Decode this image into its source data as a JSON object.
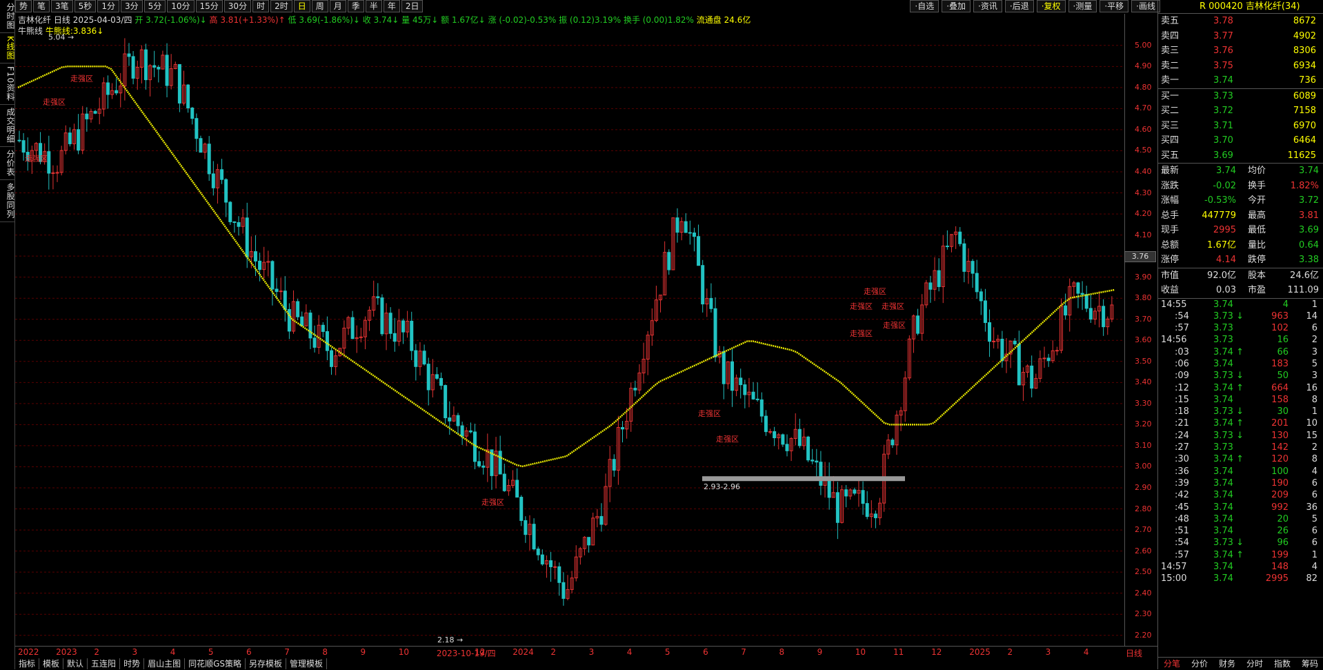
{
  "left_sidebar": [
    {
      "label": "分时图",
      "active": false
    },
    {
      "label": "K线图",
      "active": true
    },
    {
      "label": "F10资料",
      "active": false
    },
    {
      "label": "成交明细",
      "active": false
    },
    {
      "label": "分价表",
      "active": false
    },
    {
      "label": "多股同列",
      "active": false
    }
  ],
  "toolbar": [
    "势",
    "笔",
    "3笔",
    "5秒",
    "1分",
    "3分",
    "5分",
    "10分",
    "15分",
    "30分",
    "时",
    "2时",
    "日",
    "周",
    "月",
    "季",
    "半",
    "年",
    "2日"
  ],
  "toolbar_active": "日",
  "right_toolbar": [
    "自选",
    "叠加",
    "资讯",
    "后退",
    "复权",
    "测量",
    "平移",
    "画线"
  ],
  "right_toolbar_active": "复权",
  "info": {
    "stock": "吉林化纤",
    "period": "日线",
    "date": "2025-04-03/四",
    "open": "开 3.72(-1.06%)↓",
    "high": "高 3.81(+1.33%)↑",
    "low": "低 3.69(-1.86%)↓",
    "close": "收 3.74↓",
    "vol": "量 45万↓",
    "amount": "额 1.67亿↓",
    "change": "涨 (-0.02)-0.53%",
    "amp": "振 (0.12)3.19%",
    "turnover": "换手 (0.00)1.82%",
    "float": "流通盘 24.6亿",
    "indicator": "牛熊线",
    "indicator_val": "牛熊线:3.836↓"
  },
  "annotations": {
    "max": "5.04",
    "min": "2.18",
    "gap": "2.93-2.96",
    "zone_label": "走强区"
  },
  "price_badge": "3.76",
  "y_ticks": [
    "5.00",
    "4.90",
    "4.80",
    "4.70",
    "4.60",
    "4.50",
    "4.40",
    "4.30",
    "4.20",
    "4.10",
    "4.00",
    "3.90",
    "3.80",
    "3.70",
    "3.60",
    "3.50",
    "3.40",
    "3.30",
    "3.20",
    "3.10",
    "3.00",
    "2.90",
    "2.80",
    "2.70",
    "2.60",
    "2.50",
    "2.40",
    "2.30",
    "2.20"
  ],
  "x_ticks": [
    "2022",
    "2023",
    "2",
    "3",
    "4",
    "5",
    "6",
    "7",
    "8",
    "9",
    "10",
    "2023-10-19/四",
    "12",
    "2024",
    "2",
    "3",
    "4",
    "5",
    "6",
    "7",
    "8",
    "9",
    "10",
    "11",
    "12",
    "2025",
    "2",
    "3",
    "4"
  ],
  "x_axis_label": "日线",
  "bottom_toolbar": [
    "指标",
    "模板",
    "默认",
    "五连阳",
    "时势",
    "眉山主图",
    "同花顺GS策略",
    "另存模板",
    "管理模板"
  ],
  "panel": {
    "title": "R 000420 吉林化纤(34)",
    "asks": [
      [
        "卖五",
        "3.78",
        "8672"
      ],
      [
        "卖四",
        "3.77",
        "4902"
      ],
      [
        "卖三",
        "3.76",
        "8306"
      ],
      [
        "卖二",
        "3.75",
        "6934"
      ],
      [
        "卖一",
        "3.74",
        "736"
      ]
    ],
    "bids": [
      [
        "买一",
        "3.73",
        "6089"
      ],
      [
        "买二",
        "3.72",
        "7158"
      ],
      [
        "买三",
        "3.71",
        "6970"
      ],
      [
        "买四",
        "3.70",
        "6464"
      ],
      [
        "买五",
        "3.69",
        "11625"
      ]
    ],
    "stats": [
      [
        "最新",
        "3.74",
        "均价",
        "3.74"
      ],
      [
        "涨跌",
        "-0.02",
        "换手",
        "1.82%"
      ],
      [
        "涨幅",
        "-0.53%",
        "今开",
        "3.72"
      ],
      [
        "总手",
        "447779",
        "最高",
        "3.81"
      ],
      [
        "现手",
        "2995",
        "最低",
        "3.69"
      ],
      [
        "总额",
        "1.67亿",
        "量比",
        "0.64"
      ],
      [
        "涨停",
        "4.14",
        "跌停",
        "3.38"
      ]
    ],
    "cap": [
      [
        "市值",
        "92.0亿",
        "股本",
        "24.6亿"
      ],
      [
        "收益",
        "0.03",
        "市盈",
        "111.09"
      ]
    ],
    "ticks": [
      [
        "14:55",
        "3.74",
        "",
        "4",
        "1"
      ],
      [
        ":54",
        "3.73",
        "↓",
        "963",
        "14"
      ],
      [
        ":57",
        "3.73",
        "",
        "102",
        "6"
      ],
      [
        "14:56",
        "3.73",
        "",
        "16",
        "2"
      ],
      [
        ":03",
        "3.74",
        "↑",
        "66",
        "3"
      ],
      [
        ":06",
        "3.74",
        "",
        "183",
        "5"
      ],
      [
        ":09",
        "3.73",
        "↓",
        "50",
        "3"
      ],
      [
        ":12",
        "3.74",
        "↑",
        "664",
        "16"
      ],
      [
        ":15",
        "3.74",
        "",
        "158",
        "8"
      ],
      [
        ":18",
        "3.73",
        "↓",
        "30",
        "1"
      ],
      [
        ":21",
        "3.74",
        "↑",
        "201",
        "10"
      ],
      [
        ":24",
        "3.73",
        "↓",
        "130",
        "15"
      ],
      [
        ":27",
        "3.73",
        "",
        "142",
        "2"
      ],
      [
        ":30",
        "3.74",
        "↑",
        "120",
        "8"
      ],
      [
        ":36",
        "3.74",
        "",
        "100",
        "4"
      ],
      [
        ":39",
        "3.74",
        "",
        "190",
        "6"
      ],
      [
        ":42",
        "3.74",
        "",
        "209",
        "6"
      ],
      [
        ":45",
        "3.74",
        "",
        "992",
        "36"
      ],
      [
        ":48",
        "3.74",
        "",
        "20",
        "5"
      ],
      [
        ":51",
        "3.74",
        "",
        "26",
        "6"
      ],
      [
        ":54",
        "3.73",
        "↓",
        "96",
        "6"
      ],
      [
        ":57",
        "3.74",
        "↑",
        "199",
        "1"
      ],
      [
        "14:57",
        "3.74",
        "",
        "148",
        "4"
      ],
      [
        "15:00",
        "3.74",
        "",
        "2995",
        "82"
      ]
    ],
    "tabs": [
      "分笔",
      "分价",
      "财务",
      "分时",
      "指数",
      "筹码"
    ],
    "tab_active": "分笔"
  },
  "colors": {
    "up": "#e33333",
    "down": "#22c3c3",
    "ma": "#e8e800"
  },
  "chart_data": {
    "type": "candlestick",
    "ylim": [
      2.15,
      5.15
    ],
    "x": [
      "2022",
      "2023",
      "2",
      "3",
      "4",
      "5",
      "6",
      "7",
      "8",
      "9",
      "10",
      "2023-10-19/四",
      "12",
      "2024",
      "2",
      "3",
      "4",
      "5",
      "6",
      "7",
      "8",
      "9",
      "10",
      "11",
      "12",
      "2025",
      "2",
      "3",
      "4"
    ],
    "close_path": [
      4.55,
      4.45,
      4.7,
      4.95,
      4.85,
      4.4,
      4.0,
      3.7,
      3.55,
      3.75,
      3.6,
      3.25,
      3.05,
      2.75,
      2.4,
      2.85,
      3.6,
      4.25,
      3.45,
      3.25,
      3.1,
      2.8,
      2.85,
      3.7,
      4.1,
      3.6,
      3.4,
      3.8,
      3.74
    ],
    "ma_path": [
      4.8,
      4.9,
      4.9,
      4.6,
      4.3,
      4.0,
      3.7,
      3.55,
      3.4,
      3.25,
      3.1,
      3.0,
      3.05,
      3.2,
      3.4,
      3.5,
      3.6,
      3.55,
      3.4,
      3.2,
      3.2,
      3.4,
      3.6,
      3.8,
      3.84
    ]
  }
}
